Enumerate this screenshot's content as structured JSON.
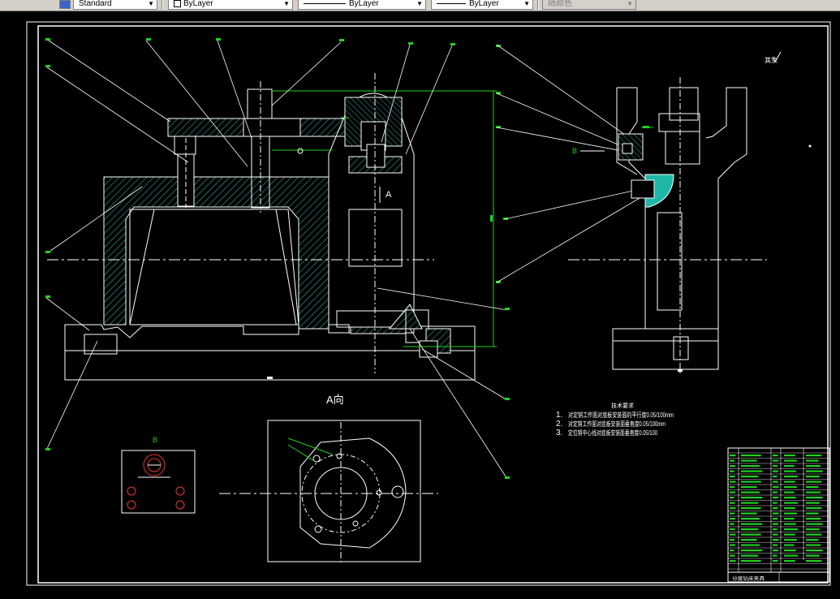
{
  "toolbar": {
    "text_style": "Standard",
    "layer": "ByLayer",
    "linetype": "ByLayer",
    "lineweight": "ByLayer",
    "plot_style": "随颜色"
  },
  "drawing": {
    "view_a_arrow_label": "A",
    "view_a_title": "A向",
    "detail_b_title": "B",
    "detail_b_pointer": "B",
    "roughness_note": "其余",
    "tech_title": "技术要求",
    "tech_req": [
      {
        "num": "1.",
        "text": "对定销工作面对底板安装面的平行度0.05/100mm"
      },
      {
        "num": "2.",
        "text": "对定销工作面对底板安装面垂直度0.05/100mm"
      },
      {
        "num": "3.",
        "text": "定位销中心线对底板安装面垂直度0.05/100"
      }
    ],
    "title_block_label": "分度钻床夹具"
  }
}
